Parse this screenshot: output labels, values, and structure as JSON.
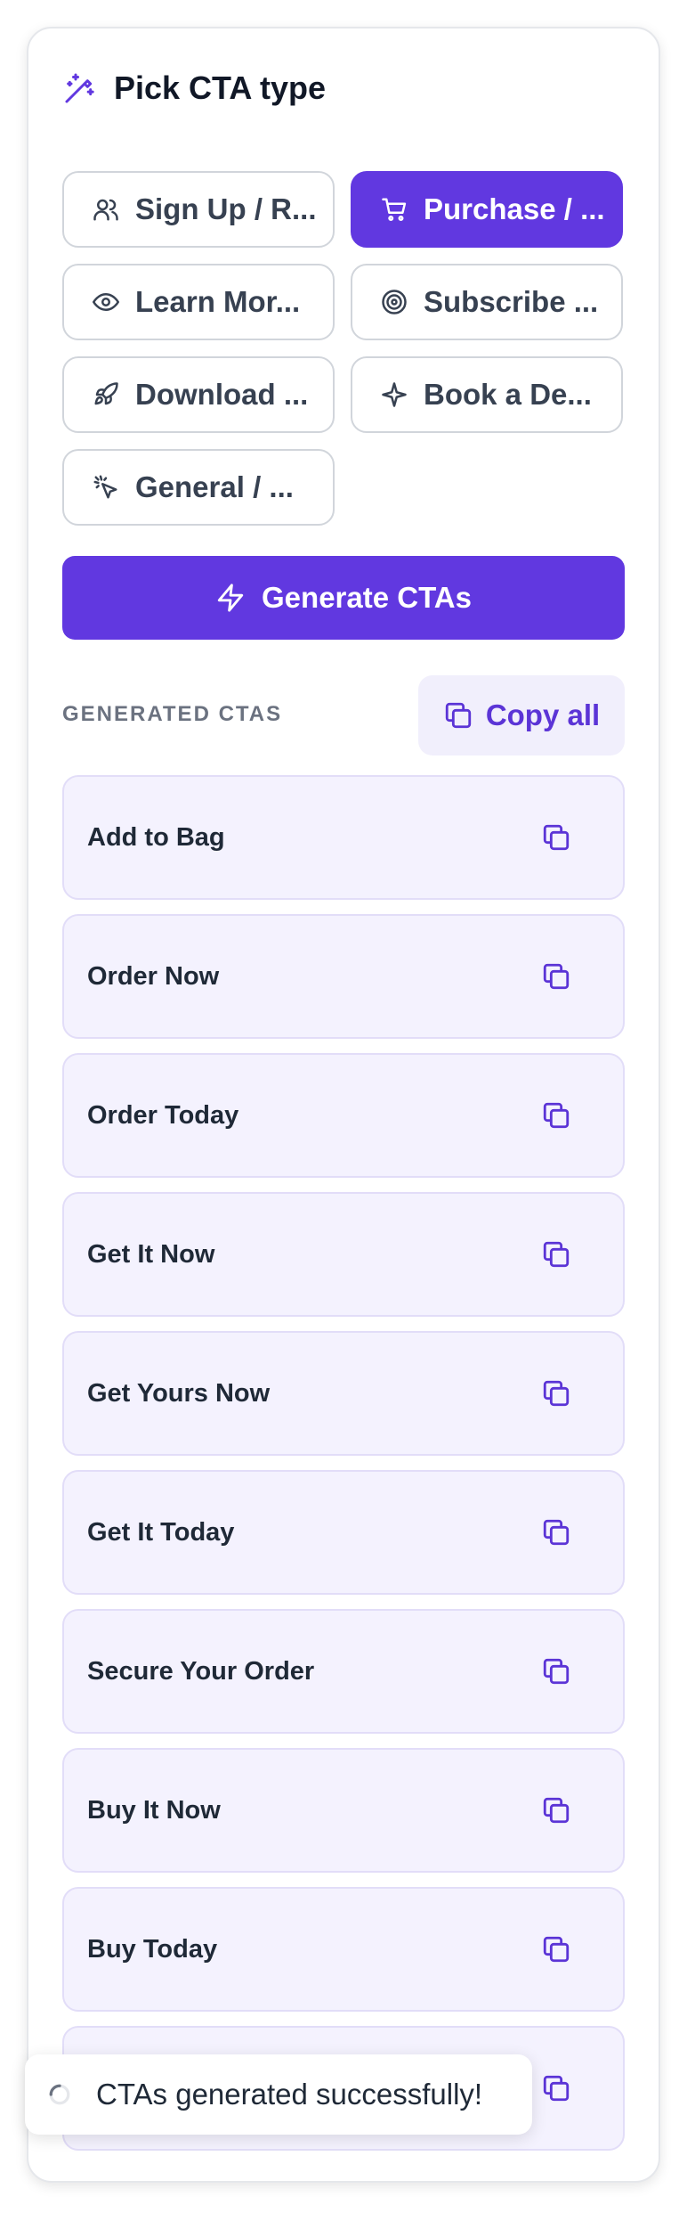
{
  "header": {
    "title": "Pick CTA type",
    "icon": "magic-wand-icon"
  },
  "cta_types": [
    {
      "label": "Sign Up / R...",
      "icon": "users-icon",
      "selected": false
    },
    {
      "label": "Purchase / ...",
      "icon": "cart-icon",
      "selected": true
    },
    {
      "label": "Learn Mor...",
      "icon": "eye-icon",
      "selected": false
    },
    {
      "label": "Subscribe ...",
      "icon": "target-icon",
      "selected": false
    },
    {
      "label": "Download ...",
      "icon": "rocket-icon",
      "selected": false
    },
    {
      "label": "Book a De...",
      "icon": "sparkle-icon",
      "selected": false
    },
    {
      "label": "General / ...",
      "icon": "pointer-click-icon",
      "selected": false
    }
  ],
  "generate_button": {
    "label": "Generate CTAs",
    "icon": "lightning-icon"
  },
  "results": {
    "section_label": "GENERATED CTAS",
    "copy_all_label": "Copy all",
    "items": [
      "Add to Bag",
      "Order Now",
      "Order Today",
      "Get It Now",
      "Get Yours Now",
      "Get It Today",
      "Secure Your Order",
      "Buy It Now",
      "Buy Today",
      ""
    ]
  },
  "toast": {
    "message": "CTAs generated successfully!"
  },
  "colors": {
    "accent": "#6138e0",
    "accent_light": "#f4f2fe",
    "border": "#d1d5db"
  }
}
